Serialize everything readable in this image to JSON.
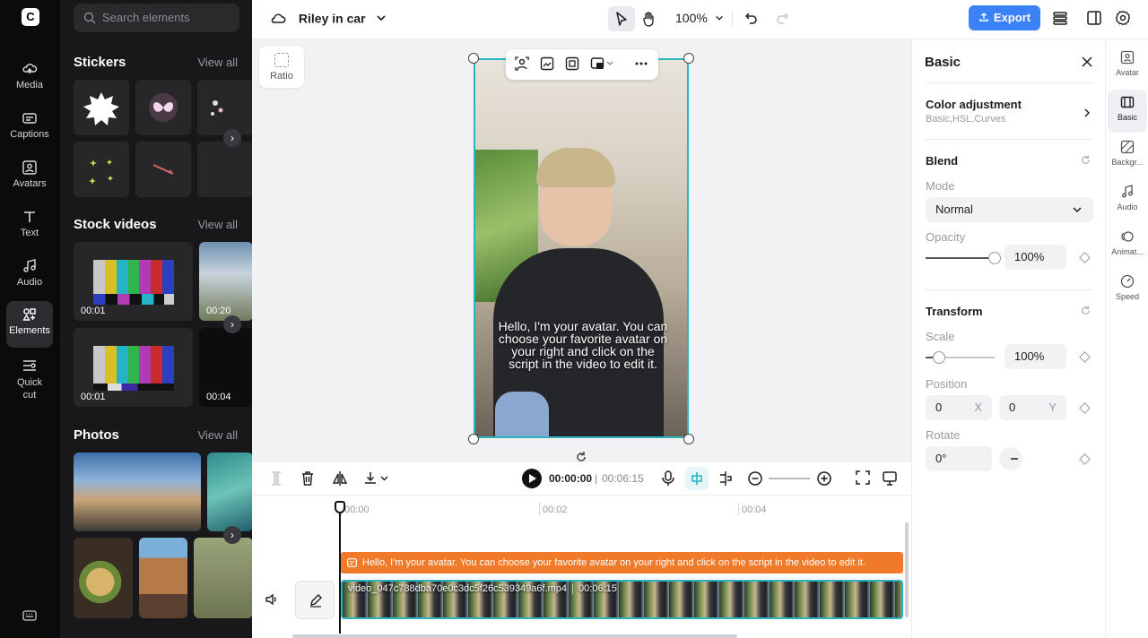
{
  "rail": {
    "items": [
      {
        "label": "Media",
        "icon": "media-icon"
      },
      {
        "label": "Captions",
        "icon": "captions-icon"
      },
      {
        "label": "Avatars",
        "icon": "avatars-icon"
      },
      {
        "label": "Text",
        "icon": "text-icon"
      },
      {
        "label": "Audio",
        "icon": "audio-icon"
      },
      {
        "label": "Elements",
        "icon": "elements-icon",
        "active": true
      },
      {
        "label": "Quick cut",
        "icon": "quick-cut-icon"
      }
    ]
  },
  "panel": {
    "search_placeholder": "Search elements",
    "stickers": {
      "title": "Stickers",
      "view_all": "View all"
    },
    "stock_videos": {
      "title": "Stock videos",
      "view_all": "View all",
      "items": [
        {
          "duration": "00:01"
        },
        {
          "duration": "00:20"
        },
        {
          "duration": "00:01"
        },
        {
          "duration": "00:04"
        }
      ]
    },
    "photos": {
      "title": "Photos",
      "view_all": "View all"
    }
  },
  "topbar": {
    "project_name": "Riley in car",
    "zoom": "100%",
    "export_label": "Export"
  },
  "canvas": {
    "ratio_label": "Ratio",
    "caption_text": "Hello, I'm your avatar. You can choose your favorite avatar on your right and click on the script in the video to edit it."
  },
  "playback": {
    "current_time": "00:00:00",
    "separator": "|",
    "total_time": "00:06:15"
  },
  "timeline": {
    "ruler": [
      "00:00",
      "00:02",
      "00:04"
    ],
    "caption_track_text": "Hello, I'm your avatar. You can choose your favorite avatar on your right and click on the script in the video to edit it.",
    "video_track_name": "video_047c788dba70e0c3dc5f26c539349a6f.mp4",
    "video_track_duration": "00:06:15"
  },
  "props": {
    "title": "Basic",
    "color_adjustment": {
      "title": "Color adjustment",
      "subtitle": "Basic,HSL,Curves"
    },
    "blend": {
      "title": "Blend",
      "mode_label": "Mode",
      "mode_value": "Normal",
      "opacity_label": "Opacity",
      "opacity_value": "100%",
      "opacity_level": 1.0
    },
    "transform": {
      "title": "Transform",
      "scale_label": "Scale",
      "scale_value": "100%",
      "position_label": "Position",
      "pos_x": "0",
      "pos_x_unit": "X",
      "pos_y": "0",
      "pos_y_unit": "Y",
      "rotate_label": "Rotate",
      "rotate_value": "0°"
    }
  },
  "right_tabs": [
    {
      "label": "Avatar",
      "icon": "avatar-icon"
    },
    {
      "label": "Basic",
      "icon": "basic-icon",
      "active": true
    },
    {
      "label": "Backgr...",
      "icon": "background-icon"
    },
    {
      "label": "Audio",
      "icon": "audio-icon"
    },
    {
      "label": "Animat...",
      "icon": "animation-icon"
    },
    {
      "label": "Speed",
      "icon": "speed-icon"
    }
  ],
  "colors": {
    "accent": "#3b82f6",
    "selection": "#2bb3c0",
    "caption_track": "#f07a2a"
  }
}
